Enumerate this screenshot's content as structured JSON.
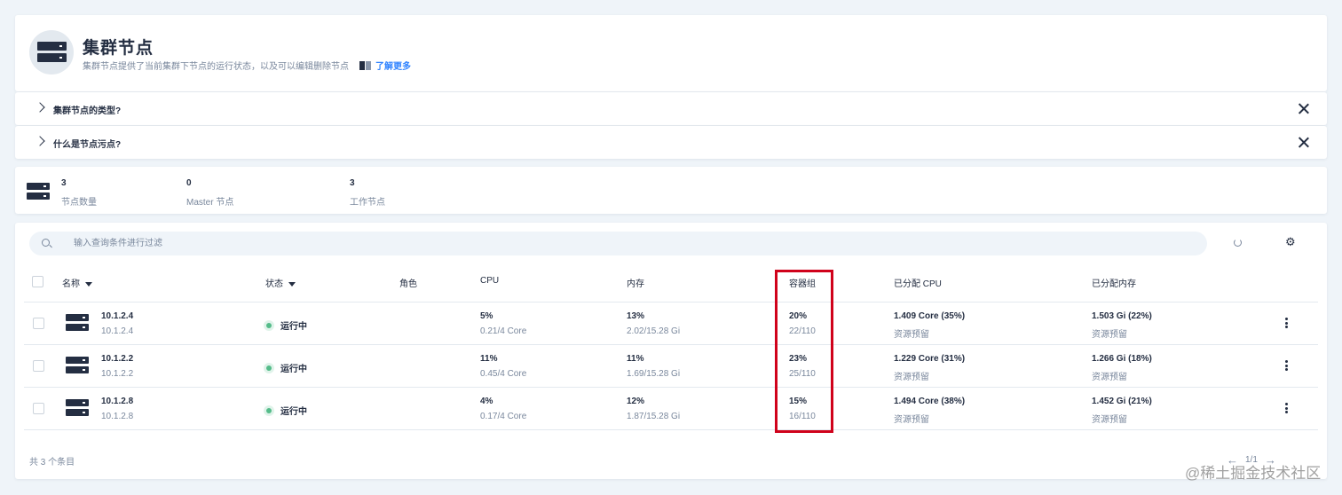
{
  "header": {
    "title": "集群节点",
    "description": "集群节点提供了当前集群下节点的运行状态，以及可以编辑删除节点",
    "learn_more": "了解更多"
  },
  "faq": [
    {
      "label": "集群节点的类型?"
    },
    {
      "label": "什么是节点污点?"
    }
  ],
  "stats": [
    {
      "value": "3",
      "label": "节点数量"
    },
    {
      "value": "0",
      "label": "Master 节点"
    },
    {
      "value": "3",
      "label": "工作节点"
    }
  ],
  "search": {
    "placeholder": "输入查询条件进行过滤"
  },
  "table": {
    "columns": {
      "name": "名称",
      "status": "状态",
      "role": "角色",
      "cpu": "CPU",
      "memory": "内存",
      "pods": "容器组",
      "alloc_cpu": "已分配 CPU",
      "alloc_mem": "已分配内存"
    },
    "rows": [
      {
        "name": "10.1.2.4",
        "ip": "10.1.2.4",
        "status": "运行中",
        "role": "",
        "cpu_pct": "5%",
        "cpu_detail": "0.21/4 Core",
        "mem_pct": "13%",
        "mem_detail": "2.02/15.28 Gi",
        "pods_pct": "20%",
        "pods_detail": "22/110",
        "alloc_cpu": "1.409 Core (35%)",
        "alloc_cpu_sub": "资源预留",
        "alloc_mem": "1.503 Gi (22%)",
        "alloc_mem_sub": "资源预留"
      },
      {
        "name": "10.1.2.2",
        "ip": "10.1.2.2",
        "status": "运行中",
        "role": "",
        "cpu_pct": "11%",
        "cpu_detail": "0.45/4 Core",
        "mem_pct": "11%",
        "mem_detail": "1.69/15.28 Gi",
        "pods_pct": "23%",
        "pods_detail": "25/110",
        "alloc_cpu": "1.229 Core (31%)",
        "alloc_cpu_sub": "资源预留",
        "alloc_mem": "1.266 Gi (18%)",
        "alloc_mem_sub": "资源预留"
      },
      {
        "name": "10.1.2.8",
        "ip": "10.1.2.8",
        "status": "运行中",
        "role": "",
        "cpu_pct": "4%",
        "cpu_detail": "0.17/4 Core",
        "mem_pct": "12%",
        "mem_detail": "1.87/15.28 Gi",
        "pods_pct": "15%",
        "pods_detail": "16/110",
        "alloc_cpu": "1.494 Core (38%)",
        "alloc_cpu_sub": "资源预留",
        "alloc_mem": "1.452 Gi (21%)",
        "alloc_mem_sub": "资源预留"
      }
    ]
  },
  "footer": {
    "total": "共 3 个条目",
    "page": "1/1"
  },
  "watermark": "@稀土掘金技术社区",
  "colors": {
    "accent": "#3385ff",
    "running": "#55bc8a",
    "highlight": "#d0021b",
    "text": "#242e42",
    "muted": "#79879c"
  },
  "icons": [
    "server-icon",
    "book-icon",
    "chevron-right-icon",
    "close-icon",
    "search-icon",
    "refresh-icon",
    "gear-icon",
    "sort-caret-icon",
    "more-icon",
    "arrow-left-icon",
    "arrow-right-icon"
  ]
}
